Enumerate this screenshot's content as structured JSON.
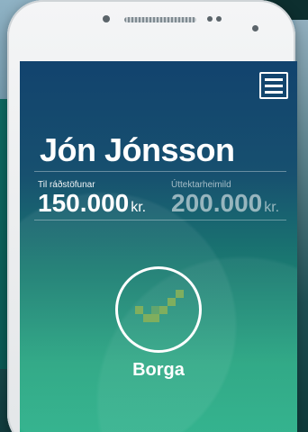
{
  "account": {
    "user_name": "Jón Jónsson",
    "available_label": "Til ráðstöfunar",
    "available_value": "150.000",
    "available_unit": "kr.",
    "limit_label": "Úttektarheimild",
    "limit_value": "200.000",
    "limit_unit": "kr."
  },
  "actions": {
    "pay_label": "Borga"
  },
  "icons": {
    "menu": "hamburger-menu-icon",
    "pay": "checkmark-icon"
  },
  "colors": {
    "screen_top": "#12436e",
    "screen_bottom": "#2ab089",
    "check": "#7fae5e"
  }
}
